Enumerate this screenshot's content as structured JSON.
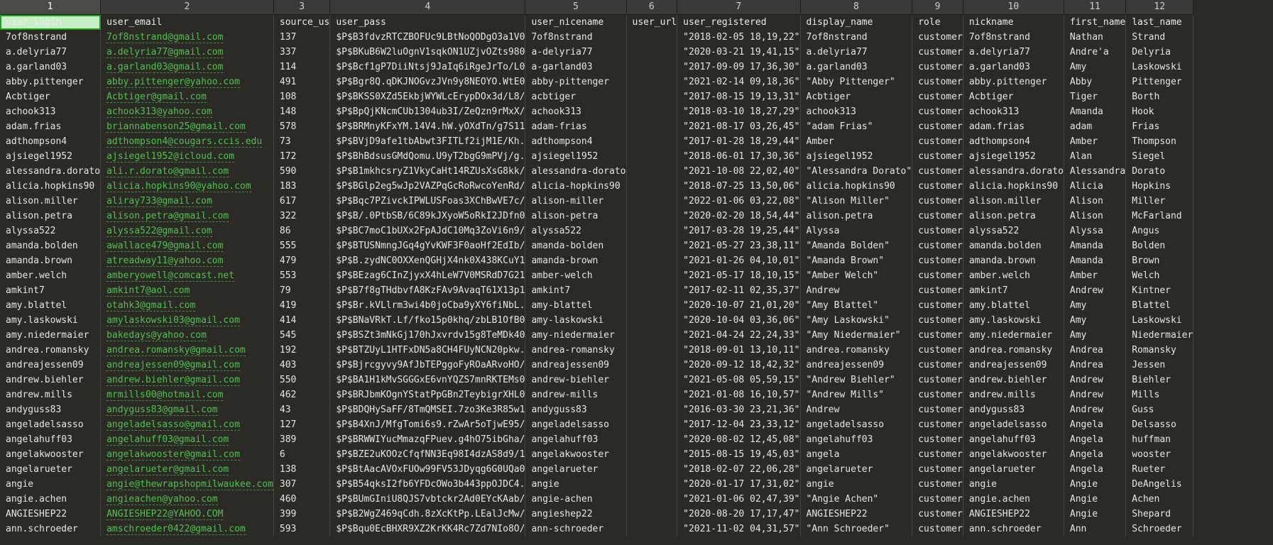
{
  "column_numbers": [
    "1",
    "2",
    "3",
    "4",
    "5",
    "6",
    "7",
    "8",
    "9",
    "10",
    "11",
    "12"
  ],
  "headers": [
    "user_login",
    "user_email",
    "source_us",
    "user_pass",
    "user_nicename",
    "user_url",
    "user_registered",
    "display_name",
    "role",
    "nickname",
    "first_name",
    "last_name"
  ],
  "rows": [
    [
      "7of8nstrand",
      "7of8nstrand@gmail.com",
      "137",
      "$P$B3fdvzRTCZBOFUc9LBtNoQODgO3a1V0",
      "7of8nstrand",
      "",
      "\"2018-02-05 18,19,22\"",
      "7of8nstrand",
      "customer",
      "7of8nstrand",
      "Nathan",
      "Strand"
    ],
    [
      "a.delyria77",
      "a.delyria77@gmail.com",
      "337",
      "$P$BKuB6W2luOgnV1sqkON1UZjvOZts980",
      "a-delyria77",
      "",
      "\"2020-03-21 19,41,15\"",
      "a.delyria77",
      "customer",
      "a.delyria77",
      "Andre'a",
      "Delyria"
    ],
    [
      "a.garland03",
      "a.garland03@gmail.com",
      "114",
      "$P$Bcf1gP7DiiNtsj9JaIq6iRgeJrTo/L0",
      "a-garland03",
      "",
      "\"2017-09-09 17,36,30\"",
      "a.garland03",
      "customer",
      "a.garland03",
      "Amy",
      "Laskowski"
    ],
    [
      "abby.pittenger",
      "abby.pittenger@yahoo.com",
      "491",
      "$P$Bgr8Q.qDKJNOGvzJVn9y8NEOYO.WtE0",
      "abby-pittenger",
      "",
      "\"2021-02-14 09,18,36\"",
      "\"Abby Pittenger\"",
      "customer",
      "abby.pittenger",
      "Abby",
      "Pittenger"
    ],
    [
      "Acbtiger",
      "Acbtiger@gmail.com",
      "108",
      "$P$BKSS0XZd5EkbjWYWLcErypDOx3d/L8/",
      "acbtiger",
      "",
      "\"2017-08-15 19,13,31\"",
      "Acbtiger",
      "customer",
      "Acbtiger",
      "Tiger",
      "Borth"
    ],
    [
      "achook313",
      "achook313@yahoo.com",
      "148",
      "$P$BpQjKNcmCUb1304ub3I/ZeQzn9rMxX/",
      "achook313",
      "",
      "\"2018-03-10 18,27,29\"",
      "achook313",
      "customer",
      "achook313",
      "Amanda",
      "Hook"
    ],
    [
      "adam.frias",
      "briannabenson25@gmail.com",
      "578",
      "$P$BRMnyKFxYM.14V4.hW.yOXdTn/g7S11",
      "adam-frias",
      "",
      "\"2021-08-17 03,26,45\"",
      "\"adam Frias\"",
      "customer",
      "adam.frias",
      "adam",
      "Frias"
    ],
    [
      "adthompson4",
      "adthompson4@cougars.ccis.edu",
      "73",
      "$P$BVjD9afe1tbAbwt3FITLf2ijM1E/Kh.",
      "adthompson4",
      "",
      "\"2017-01-28 18,29,44\"",
      "Amber",
      "customer",
      "adthompson4",
      "Amber",
      "Thompson"
    ],
    [
      "ajsiegel1952",
      "ajsiegel1952@icloud.com",
      "172",
      "$P$BhBdsusGMdQomu.U9yT2bgG9mPVj/g.",
      "ajsiegel1952",
      "",
      "\"2018-06-01 17,30,36\"",
      "ajsiegel1952",
      "customer",
      "ajsiegel1952",
      "Alan",
      "Siegel"
    ],
    [
      "alessandra.dorato",
      "ali.r.dorato@gmail.com",
      "590",
      "$P$B1mkhcsryZ1VkyCaHt14RZUsXsG8kk/",
      "alessandra-dorato",
      "",
      "\"2021-10-08 22,02,40\"",
      "\"Alessandra Dorato\"",
      "customer",
      "alessandra.dorato",
      "Alessandra",
      "Dorato"
    ],
    [
      "alicia.hopkins90",
      "alicia.hopkins90@yahoo.com",
      "183",
      "$P$BGlp2eg5wJp2VAZPqGcRoRwcoYenRd/",
      "alicia-hopkins90",
      "",
      "\"2018-07-25 13,50,06\"",
      "alicia.hopkins90",
      "customer",
      "alicia.hopkins90",
      "Alicia",
      "Hopkins"
    ],
    [
      "alison.miller",
      "aliray733@gmail.com",
      "617",
      "$P$Bqc7PZivckIPWLUSFoas3XChBwVE7c/",
      "alison-miller",
      "",
      "\"2022-01-06 03,22,08\"",
      "\"Alison Miller\"",
      "customer",
      "alison.miller",
      "Alison",
      "Miller"
    ],
    [
      "alison.petra",
      "alison.petra@gmail.com",
      "322",
      "$P$B/.0PtbSB/6C89kJXyoW5oRkI2JDfn0",
      "alison-petra",
      "",
      "\"2020-02-20 18,54,44\"",
      "alison.petra",
      "customer",
      "alison.petra",
      "Alison",
      "McFarland"
    ],
    [
      "alyssa522",
      "alyssa522@gmail.com",
      "86",
      "$P$BC7moC1bUXx2FpAJdC10Mq3ZoVi6n9/",
      "alyssa522",
      "",
      "\"2017-03-28 19,25,44\"",
      "Alyssa",
      "customer",
      "alyssa522",
      "Alyssa",
      "Angus"
    ],
    [
      "amanda.bolden",
      "awallace479@gmail.com",
      "555",
      "$P$BTUSNmngJGq4gYvKWF3F0aoHf2EdIb/",
      "amanda-bolden",
      "",
      "\"2021-05-27 23,38,11\"",
      "\"Amanda Bolden\"",
      "customer",
      "amanda.bolden",
      "Amanda",
      "Bolden"
    ],
    [
      "amanda.brown",
      "atreadway11@yahoo.com",
      "479",
      "$P$B.zydNC0OXXenQGHjX4nk0X438KCuY1",
      "amanda-brown",
      "",
      "\"2021-01-26 04,10,01\"",
      "\"Amanda Brown\"",
      "customer",
      "amanda.brown",
      "Amanda",
      "Brown"
    ],
    [
      "amber.welch",
      "amberyowell@comcast.net",
      "553",
      "$P$BEzag6CInZjyxX4hLeW7V0MSRdD7G21",
      "amber-welch",
      "",
      "\"2021-05-17 18,10,15\"",
      "\"Amber Welch\"",
      "customer",
      "amber.welch",
      "Amber",
      "Welch"
    ],
    [
      "amkint7",
      "amkint7@aol.com",
      "79",
      "$P$B7f8gTHdbvfA8KzFAv9AvaqT61X13p1",
      "amkint7",
      "",
      "\"2017-02-11 02,35,37\"",
      "Andrew",
      "customer",
      "amkint7",
      "Andrew",
      "Kintner"
    ],
    [
      "amy.blattel",
      "otahk3@gmail.com",
      "419",
      "$P$Br.kVLlrm3wi4b0joCba9yXY6fiNbL.",
      "amy-blattel",
      "",
      "\"2020-10-07 21,01,20\"",
      "\"Amy Blattel\"",
      "customer",
      "amy.blattel",
      "Amy",
      "Blattel"
    ],
    [
      "amy.laskowski",
      "amylaskowski03@gmail.com",
      "414",
      "$P$BNaVRkT.Lf/fko15p0khq/zbLB1OfB0",
      "amy-laskowski",
      "",
      "\"2020-10-04 03,36,06\"",
      "\"Amy Laskowski\"",
      "customer",
      "amy.laskowski",
      "Amy",
      "Laskowski"
    ],
    [
      "amy.niedermaier",
      "bakedays@yahoo.com",
      "545",
      "$P$BSZt3mNkGj170hJxvrdv15g8TeMDk40",
      "amy-niedermaier",
      "",
      "\"2021-04-24 22,24,33\"",
      "\"Amy Niedermaier\"",
      "customer",
      "amy.niedermaier",
      "Amy",
      "Niedermaier"
    ],
    [
      "andrea.romansky",
      "andrea.romansky@gmail.com",
      "192",
      "$P$BTZUyL1HTFxDN5a8CH4FUyNCN20pkw.",
      "andrea-romansky",
      "",
      "\"2018-09-01 13,10,11\"",
      "andrea.romansky",
      "customer",
      "andrea.romansky",
      "Andrea",
      "Romansky"
    ],
    [
      "andreajessen09",
      "andreajessen09@gmail.com",
      "403",
      "$P$Bjrcgyvy9AfJbTEPggoFyROaARvoHO/",
      "andreajessen09",
      "",
      "\"2020-09-12 18,42,32\"",
      "andreajessen09",
      "customer",
      "andreajessen09",
      "Andrea",
      "Jessen"
    ],
    [
      "andrew.biehler",
      "andrew.biehler@gmail.com",
      "550",
      "$P$BA1H1kMvSGGGxE6vnYQZS7mnRKTEMs0",
      "andrew-biehler",
      "",
      "\"2021-05-08 05,59,15\"",
      "\"Andrew Biehler\"",
      "customer",
      "andrew.biehler",
      "Andrew",
      "Biehler"
    ],
    [
      "andrew.mills",
      "mrmills00@hotmail.com",
      "462",
      "$P$BRJbmKOgnYStatPpGBn2TeybigrXHL0",
      "andrew-mills",
      "",
      "\"2021-01-08 16,10,57\"",
      "\"Andrew Mills\"",
      "customer",
      "andrew.mills",
      "Andrew",
      "Mills"
    ],
    [
      "andyguss83",
      "andyguss83@gmail.com",
      "43",
      "$P$BDQHySaFF/8TmQMSEI.7zo3Ke3R85w1",
      "andyguss83",
      "",
      "\"2016-03-30 23,21,36\"",
      "Andrew",
      "customer",
      "andyguss83",
      "Andrew",
      "Guss"
    ],
    [
      "angeladelsasso",
      "angeladelsasso@gmail.com",
      "127",
      "$P$B4XnJ/MfgTomi6s9.rZwAr5oTjwE95/",
      "angeladelsasso",
      "",
      "\"2017-12-04 23,33,12\"",
      "angeladelsasso",
      "customer",
      "angeladelsasso",
      "Angela",
      "Delsasso"
    ],
    [
      "angelahuff03",
      "angelahuff03@gmail.com",
      "389",
      "$P$BRWWIYucMmazqFPuev.g4hO75ibGha/",
      "angelahuff03",
      "",
      "\"2020-08-02 12,45,08\"",
      "angelahuff03",
      "customer",
      "angelahuff03",
      "Angela",
      "huffman"
    ],
    [
      "angelakwooster",
      "angelakwooster@gmail.com",
      "6",
      "$P$BZE2uKOOzCfqfNN3Eq98I4dzAS8d9/1",
      "angelakwooster",
      "",
      "\"2015-08-15 19,45,03\"",
      "angela",
      "customer",
      "angelakwooster",
      "Angela",
      "wooster"
    ],
    [
      "angelarueter",
      "angelarueter@gmail.com",
      "138",
      "$P$BtAacAVOxFUOw99FV53JDyqg6G0UQa0",
      "angelarueter",
      "",
      "\"2018-02-07 22,06,28\"",
      "angelarueter",
      "customer",
      "angelarueter",
      "Angela",
      "Rueter"
    ],
    [
      "angie",
      "angie@thewrapshopmilwaukee.com",
      "307",
      "$P$B54qksI2fb6YFDcOWo3b443ppOJDC4.",
      "angie",
      "",
      "\"2020-01-17 17,31,02\"",
      "angie",
      "customer",
      "angie",
      "Angie",
      "DeAngelis"
    ],
    [
      "angie.achen",
      "angieachen@yahoo.com",
      "460",
      "$P$BUmGIniU8QJS7vbtckr2Ad0EYcKAab/",
      "angie-achen",
      "",
      "\"2021-01-06 02,47,39\"",
      "\"Angie Achen\"",
      "customer",
      "angie.achen",
      "Angie",
      "Achen"
    ],
    [
      "ANGIESHEP22",
      "ANGIESHEP22@YAHOO.COM",
      "399",
      "$P$B2WgZ469qCdh.8zXcKtPp.LEalJcMw/",
      "angieshep22",
      "",
      "\"2020-08-20 17,17,47\"",
      "ANGIESHEP22",
      "customer",
      "ANGIESHEP22",
      "Angie",
      "Shepard"
    ],
    [
      "ann.schroeder",
      "amschroeder0422@gmail.com",
      "593",
      "$P$Bqu0EcBHXR9XZ2KrKK4Rc7Zd7NIo8O/",
      "ann-schroeder",
      "",
      "\"2021-11-02 04,31,57\"",
      "\"Ann Schroeder\"",
      "customer",
      "ann.schroeder",
      "Ann",
      "Schroeder"
    ]
  ]
}
